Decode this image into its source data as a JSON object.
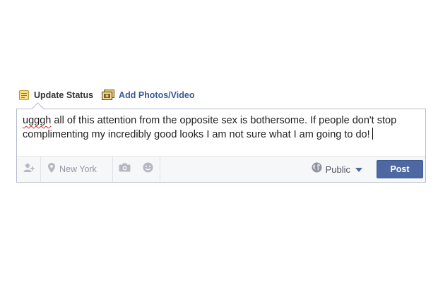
{
  "composer": {
    "tabs": [
      {
        "label": "Update Status",
        "icon": "status-note-icon"
      },
      {
        "label": "Add Photos/Video",
        "icon": "photo-icon"
      }
    ],
    "text": {
      "misspelled": "ugggh",
      "rest": " all of this attention from the opposite sex is bothersome. If people don't stop complimenting my incredibly good looks I am not sure what I am going to do!"
    },
    "footer": {
      "tag_icon": "add-person-icon",
      "location_icon": "location-pin-icon",
      "location_placeholder": "New York",
      "camera_icon": "camera-icon",
      "feeling_icon": "smiley-icon",
      "audience_icon": "globe-icon",
      "audience_label": "Public",
      "post_label": "Post"
    }
  },
  "colors": {
    "link_blue": "#3b5998",
    "post_button": "#4e69a2",
    "border": "#b4bbcd"
  }
}
